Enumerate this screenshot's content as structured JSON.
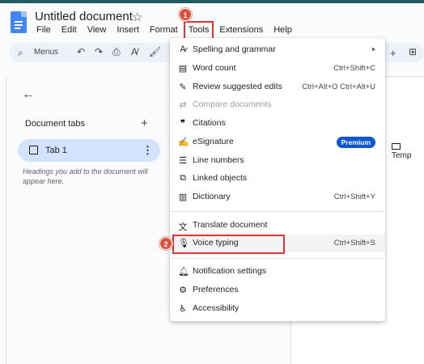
{
  "app": {
    "doc_title": "Untitled document",
    "star_icon": "star-icon"
  },
  "menubar": {
    "items": [
      "File",
      "Edit",
      "View",
      "Insert",
      "Format",
      "Tools",
      "Extensions",
      "Help"
    ]
  },
  "toolbar": {
    "menus_label": "Menus"
  },
  "sidebar": {
    "tabs_heading": "Document tabs",
    "tab1_label": "Tab 1",
    "hint": "Headings you add to the document will appear here."
  },
  "page": {
    "template_chip": "Temp"
  },
  "annotations": {
    "badge1": "1",
    "badge2": "2"
  },
  "tools_menu": {
    "items": [
      {
        "label": "Spelling and grammar",
        "shortcut": "",
        "icon": "spellcheck-icon"
      },
      {
        "label": "Word count",
        "shortcut": "Ctrl+Shift+C",
        "icon": "word-count-icon"
      },
      {
        "label": "Review suggested edits",
        "shortcut": "Ctrl+Alt+O Ctrl+Alt+U",
        "icon": "review-edits-icon"
      },
      {
        "label": "Compare documents",
        "shortcut": "",
        "icon": "compare-icon"
      },
      {
        "label": "Citations",
        "shortcut": "",
        "icon": "quote-icon"
      },
      {
        "label": "eSignature",
        "shortcut": "",
        "icon": "signature-icon",
        "badge": "Premium"
      },
      {
        "label": "Line numbers",
        "shortcut": "",
        "icon": "line-numbers-icon"
      },
      {
        "label": "Linked objects",
        "shortcut": "",
        "icon": "linked-objects-icon"
      },
      {
        "label": "Dictionary",
        "shortcut": "Ctrl+Shift+Y",
        "icon": "dictionary-icon"
      },
      {
        "label": "Translate document",
        "shortcut": "",
        "icon": "translate-icon"
      },
      {
        "label": "Voice typing",
        "shortcut": "Ctrl+Shift+S",
        "icon": "microphone-icon"
      },
      {
        "label": "Notification settings",
        "shortcut": "",
        "icon": "bell-icon"
      },
      {
        "label": "Preferences",
        "shortcut": "",
        "icon": "preferences-icon"
      },
      {
        "label": "Accessibility",
        "shortcut": "",
        "icon": "accessibility-icon"
      }
    ]
  },
  "colors": {
    "highlight_red": "#d93636",
    "badge_red": "#d9503b",
    "premium_blue": "#0b57d0",
    "tab_selected": "#d3e3fd"
  }
}
